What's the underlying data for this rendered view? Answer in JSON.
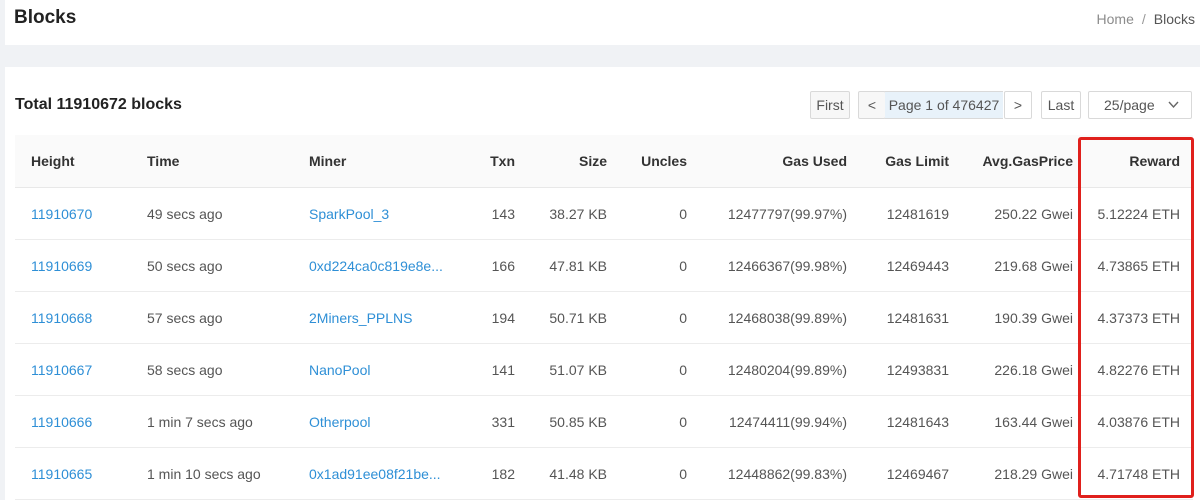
{
  "header": {
    "title": "Blocks",
    "breadcrumb": {
      "home": "Home",
      "separator": "/",
      "current": "Blocks"
    }
  },
  "summary": {
    "total_text": "Total 11910672 blocks"
  },
  "pagination": {
    "first": "First",
    "prev": "<",
    "page_text": "Page 1 of 476427",
    "next": ">",
    "last": "Last",
    "page_size": "25/page"
  },
  "table": {
    "columns": [
      "Height",
      "Time",
      "Miner",
      "Txn",
      "Size",
      "Uncles",
      "Gas Used",
      "Gas Limit",
      "Avg.GasPrice",
      "Reward"
    ],
    "rows": [
      {
        "height": "11910670",
        "time": "49 secs ago",
        "miner": "SparkPool_3",
        "txn": "143",
        "size": "38.27 KB",
        "uncles": "0",
        "gas_used": "12477797(99.97%)",
        "gas_limit": "12481619",
        "avg_gas_price": "250.22 Gwei",
        "reward": "5.12224 ETH"
      },
      {
        "height": "11910669",
        "time": "50 secs ago",
        "miner": "0xd224ca0c819e8e...",
        "txn": "166",
        "size": "47.81 KB",
        "uncles": "0",
        "gas_used": "12466367(99.98%)",
        "gas_limit": "12469443",
        "avg_gas_price": "219.68 Gwei",
        "reward": "4.73865 ETH"
      },
      {
        "height": "11910668",
        "time": "57 secs ago",
        "miner": "2Miners_PPLNS",
        "txn": "194",
        "size": "50.71 KB",
        "uncles": "0",
        "gas_used": "12468038(99.89%)",
        "gas_limit": "12481631",
        "avg_gas_price": "190.39 Gwei",
        "reward": "4.37373 ETH"
      },
      {
        "height": "11910667",
        "time": "58 secs ago",
        "miner": "NanoPool",
        "txn": "141",
        "size": "51.07 KB",
        "uncles": "0",
        "gas_used": "12480204(99.89%)",
        "gas_limit": "12493831",
        "avg_gas_price": "226.18 Gwei",
        "reward": "4.82276 ETH"
      },
      {
        "height": "11910666",
        "time": "1 min 7 secs ago",
        "miner": "Otherpool",
        "txn": "331",
        "size": "50.85 KB",
        "uncles": "0",
        "gas_used": "12474411(99.94%)",
        "gas_limit": "12481643",
        "avg_gas_price": "163.44 Gwei",
        "reward": "4.03876 ETH"
      },
      {
        "height": "11910665",
        "time": "1 min 10 secs ago",
        "miner": "0x1ad91ee08f21be...",
        "txn": "182",
        "size": "41.48 KB",
        "uncles": "0",
        "gas_used": "12448862(99.83%)",
        "gas_limit": "12469467",
        "avg_gas_price": "218.29 Gwei",
        "reward": "4.71748 ETH"
      }
    ]
  },
  "colors": {
    "link": "#2e8fd6",
    "highlight_border": "#e0201c",
    "page_background": "#f0f2f5",
    "active_page_bg": "#e8f2fa"
  },
  "icons": {
    "page_size_dropdown": "chevron-down-icon"
  }
}
